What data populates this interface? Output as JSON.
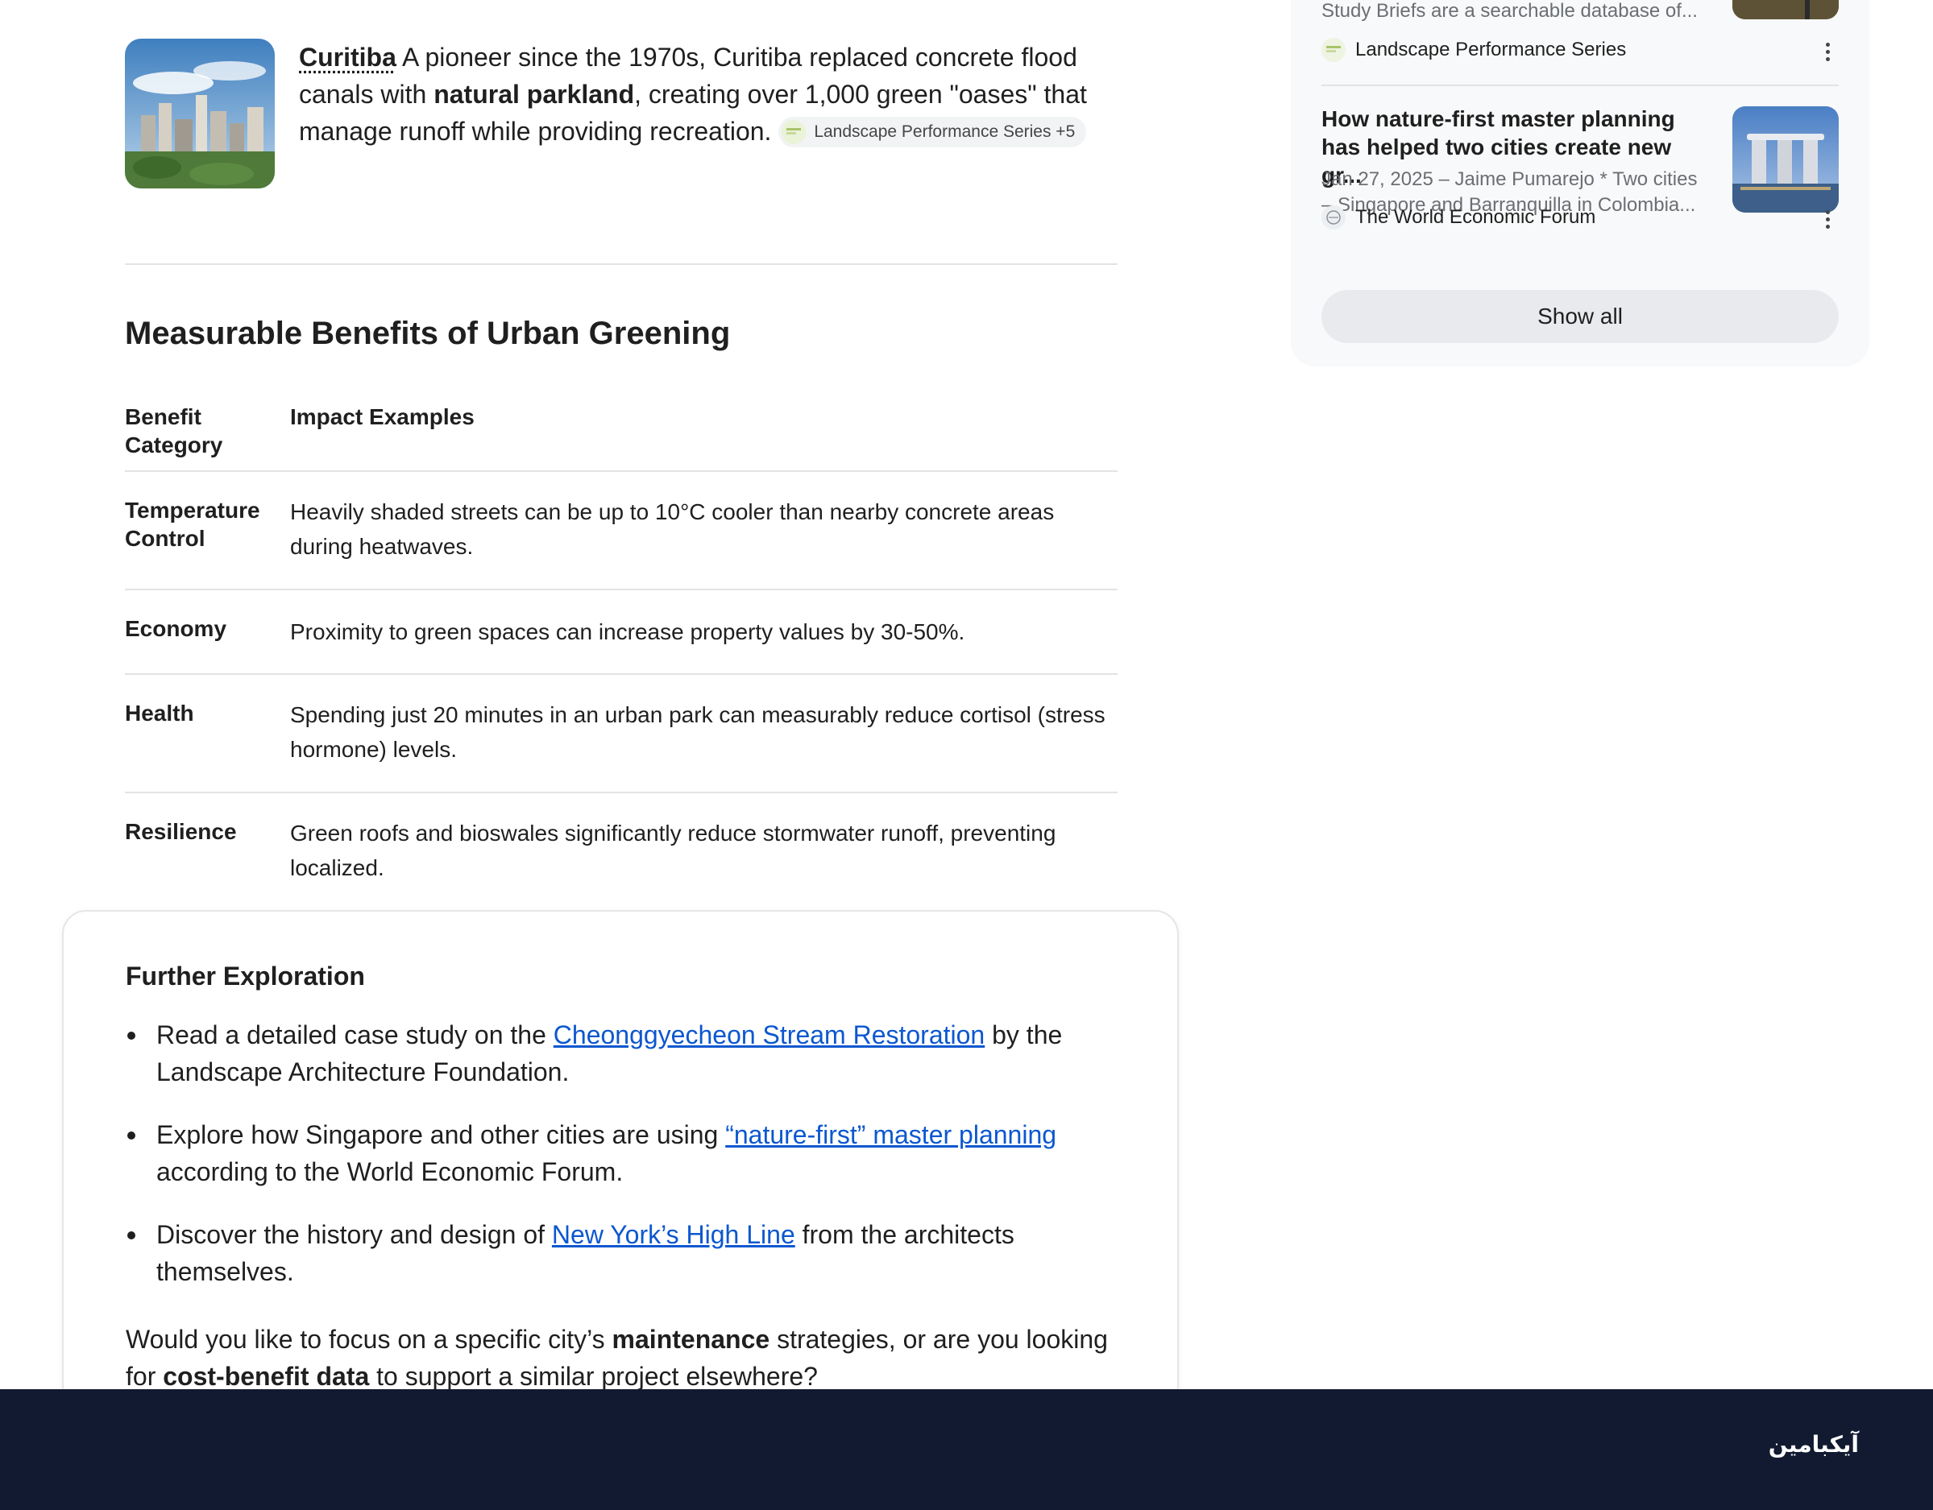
{
  "city": {
    "name": "Curitiba",
    "text_1": " A pioneer since the 1970s, Curitiba replaced concrete flood canals with ",
    "bold": "natural parkland",
    "text_2": ", creating over 1,000 green \"oases\" that manage runoff while providing recreation. ",
    "chip": "Landscape Performance Series +5"
  },
  "section": {
    "title": "Measurable Benefits of Urban Greening"
  },
  "table": {
    "headers": [
      "Benefit Category",
      "Impact Examples"
    ],
    "rows": [
      {
        "category": "Temperature Control",
        "impact": "Heavily shaded streets can be up to 10°C cooler than nearby concrete areas during heatwaves."
      },
      {
        "category": "Economy",
        "impact": "Proximity to green spaces can increase property values by 30-50%."
      },
      {
        "category": "Health",
        "impact": "Spending just 20 minutes in an urban park can measurably reduce cortisol (stress hormone) levels."
      },
      {
        "category": "Resilience",
        "impact": "Green roofs and bioswales significantly reduce stormwater runoff, preventing localized."
      }
    ]
  },
  "explore": {
    "title": "Further Exploration",
    "items": [
      {
        "before": "Read a detailed case study on the ",
        "link": "Cheonggyecheon Stream Restoration",
        "after": " by the Landscape Architecture Foundation."
      },
      {
        "before": "Explore how Singapore and other cities are using ",
        "link": "“nature-first” master planning",
        "after": " according to the World Economic Forum."
      },
      {
        "before": "Discover the history and design of ",
        "link": "New York’s High Line",
        "after": " from the architects themselves."
      }
    ],
    "closing": {
      "t1": "Would you like to focus on a specific city’s ",
      "b1": "maintenance",
      "t2": " strategies, or are you looking for ",
      "b2": "cost-benefit data",
      "t3": " to support a similar project elsewhere?"
    }
  },
  "sidebar": {
    "item1": {
      "snippet": "Study Briefs are a searchable database of...",
      "source": "Landscape Performance Series"
    },
    "item2": {
      "title": "How nature-first master planning has helped two cities create new gr...",
      "snippet": "Jan 27, 2025 – Jaime Pumarejo * Two cities – Singapore and Barranquilla in Colombia...",
      "source": "The World Economic Forum"
    },
    "show_all": "Show all"
  },
  "footer": {
    "logo": "آیکبامین"
  },
  "colors": {
    "link": "#0b57d0",
    "footer_bg": "#111a30",
    "panel_bg": "#f8f9fa"
  }
}
